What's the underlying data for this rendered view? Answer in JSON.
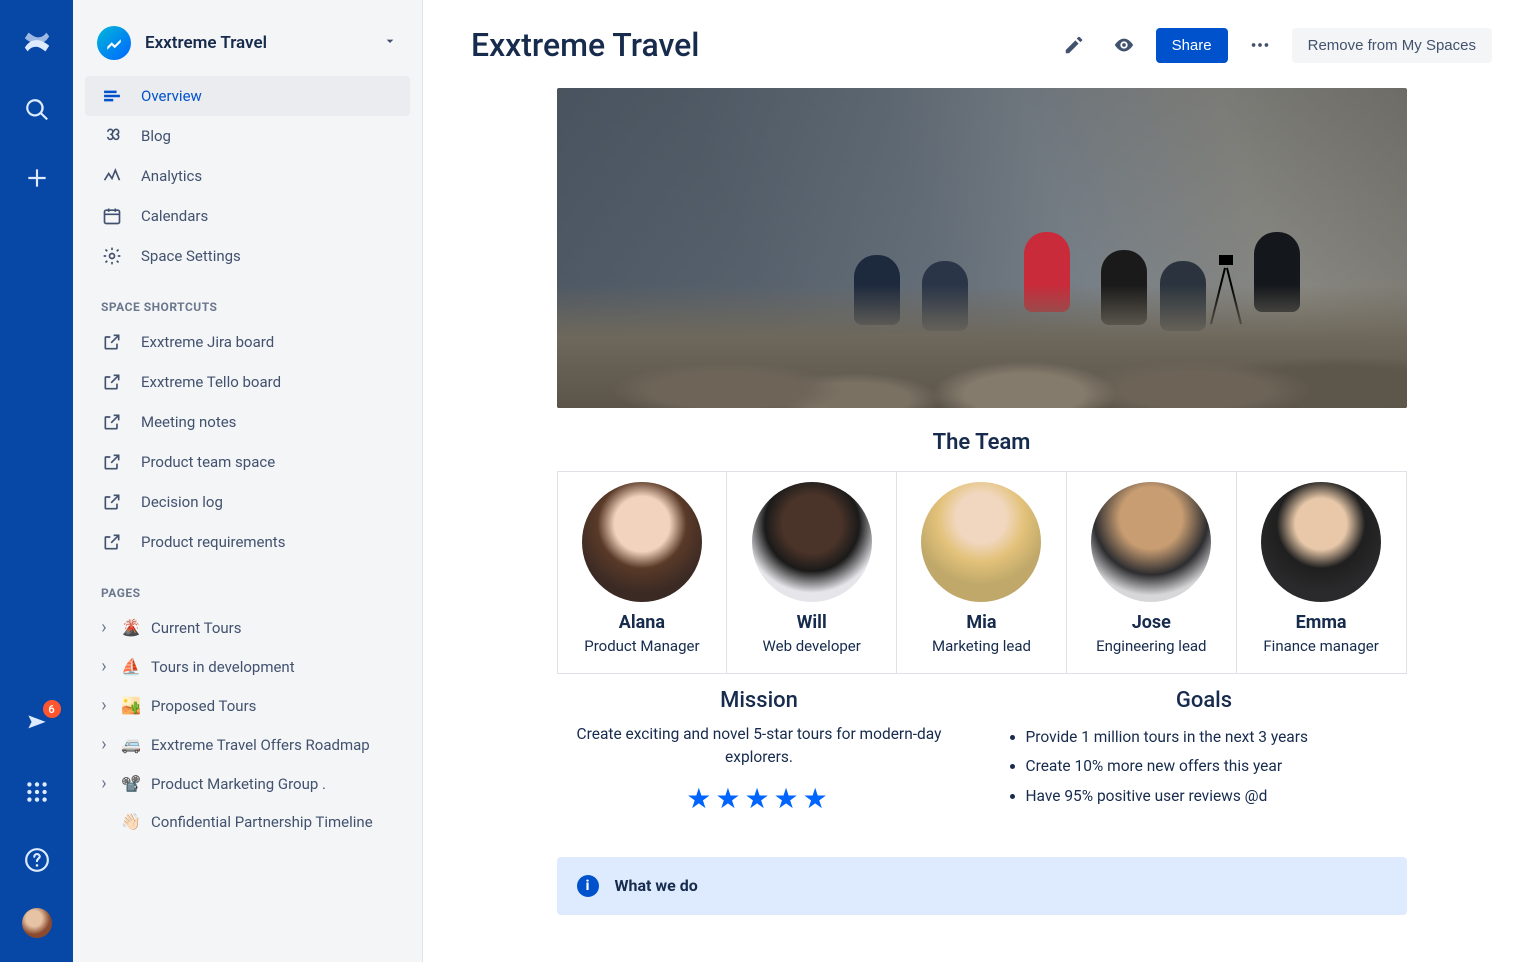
{
  "rail": {
    "notification_count": "6"
  },
  "sidebar": {
    "space_name": "Exxtreme Travel",
    "nav": [
      {
        "label": "Overview"
      },
      {
        "label": "Blog"
      },
      {
        "label": "Analytics"
      },
      {
        "label": "Calendars"
      },
      {
        "label": "Space Settings"
      }
    ],
    "shortcuts_heading": "SPACE SHORTCUTS",
    "shortcuts": [
      {
        "label": "Exxtreme Jira board"
      },
      {
        "label": "Exxtreme Tello board"
      },
      {
        "label": "Meeting notes"
      },
      {
        "label": "Product team space"
      },
      {
        "label": "Decision log"
      },
      {
        "label": "Product requirements"
      }
    ],
    "pages_heading": "PAGES",
    "pages": [
      {
        "emoji": "🌋",
        "label": "Current Tours"
      },
      {
        "emoji": "⛵",
        "label": "Tours in development"
      },
      {
        "emoji": "🏜️",
        "label": "Proposed Tours"
      },
      {
        "emoji": "🚐",
        "label": "Exxtreme Travel Offers Roadmap"
      },
      {
        "emoji": "📽️",
        "label": "Product Marketing Group ."
      },
      {
        "emoji": "👋🏻",
        "label": "Confidential Partnership Timeline"
      }
    ]
  },
  "header": {
    "title": "Exxtreme Travel",
    "share_label": "Share",
    "remove_label": "Remove from My Spaces"
  },
  "team": {
    "heading": "The Team",
    "members": [
      {
        "name": "Alana",
        "role": "Product Manager"
      },
      {
        "name": "Will",
        "role": "Web developer"
      },
      {
        "name": "Mia",
        "role": "Marketing lead"
      },
      {
        "name": "Jose",
        "role": "Engineering lead"
      },
      {
        "name": "Emma",
        "role": "Finance manager"
      }
    ]
  },
  "mission": {
    "heading": "Mission",
    "text": "Create exciting and novel 5-star tours for modern-day explorers.",
    "stars": "★★★★★"
  },
  "goals": {
    "heading": "Goals",
    "items": [
      "Provide 1 million tours in the next 3 years",
      "Create 10% more new offers this year",
      "Have 95% positive user reviews @d"
    ]
  },
  "panel": {
    "title": "What we do"
  }
}
